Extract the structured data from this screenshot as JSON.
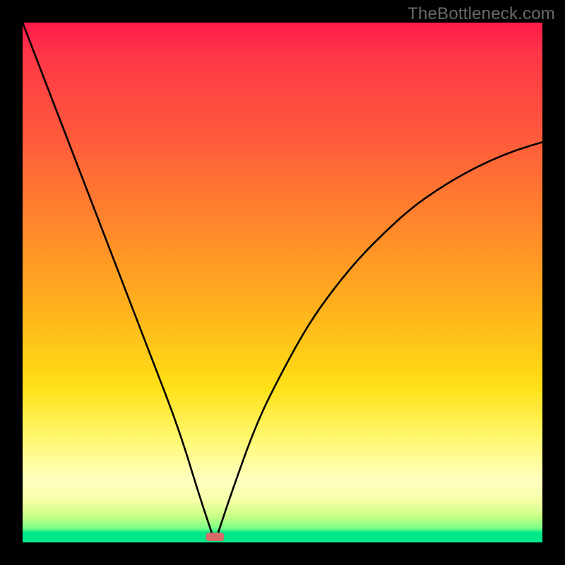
{
  "watermark": {
    "text": "TheBottleneck.com"
  },
  "colors": {
    "curve": "#000000",
    "notch_fill": "#d86a6a",
    "background_black": "#000000",
    "gradient_top": "#ff1a49",
    "gradient_bottom": "#00e88a"
  },
  "chart_data": {
    "type": "line",
    "title": "",
    "xlabel": "",
    "ylabel": "",
    "xlim": [
      0,
      100
    ],
    "ylim": [
      0,
      100
    ],
    "grid": false,
    "series": [
      {
        "name": "curve",
        "x": [
          0,
          5,
          10,
          15,
          20,
          25,
          30,
          34,
          36,
          37,
          38,
          40,
          45,
          50,
          55,
          60,
          65,
          70,
          75,
          80,
          85,
          90,
          95,
          100
        ],
        "y": [
          100,
          87,
          74,
          61,
          48,
          35,
          22,
          9,
          3,
          0,
          3,
          9,
          23,
          33,
          42,
          49,
          55,
          60,
          64.5,
          68,
          71,
          73.5,
          75.5,
          77
        ]
      }
    ],
    "annotations": [
      {
        "type": "notch",
        "x": 37,
        "y": 0,
        "w": 3.5,
        "h": 1.6,
        "color": "#d86a6a"
      }
    ]
  }
}
